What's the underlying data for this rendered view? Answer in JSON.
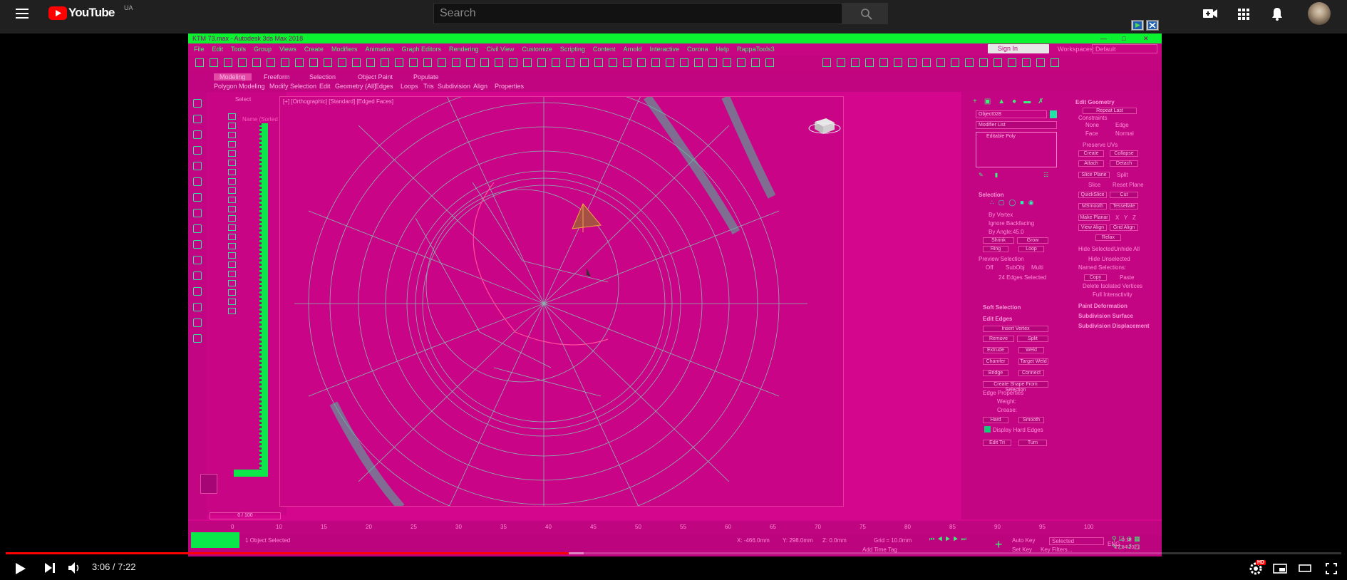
{
  "youtube": {
    "logo_text": "YouTube",
    "region": "UA",
    "search_placeholder": "Search",
    "icons": [
      "menu-icon",
      "youtube-logo-icon",
      "search-icon",
      "create-video-icon",
      "apps-icon",
      "notifications-icon",
      "avatar"
    ]
  },
  "max": {
    "window_title": "KTM 73.max - Autodesk 3ds Max 2018",
    "menu": [
      "File",
      "Edit",
      "Tools",
      "Group",
      "Views",
      "Create",
      "Modifiers",
      "Animation",
      "Graph Editors",
      "Rendering",
      "Civil View",
      "Customize",
      "Scripting",
      "Content",
      "Arnold",
      "Interactive",
      "Corona",
      "Help",
      "RappaTools3"
    ],
    "sign_in": "Sign In",
    "workspace_label": "Workspaces:",
    "workspace_value": "Default",
    "ribbon_tabs": [
      "Modeling",
      "Freeform",
      "Selection",
      "Object Paint",
      "Populate"
    ],
    "ribbon_subtabs": [
      "Polygon Modeling",
      "Modify Selection",
      "Edit",
      "Geometry (All)",
      "Edges",
      "Loops",
      "Tris",
      "Subdivision",
      "Align",
      "Properties"
    ],
    "viewport_label": "[+] [Orthographic] [Standard] [Edged Faces]",
    "scene_explorer_select": "Select",
    "scene_explorer_name": "Name (Sorted",
    "command_panel": {
      "object_name": "Object028",
      "modifier_list": "Modifier List",
      "stack_item": "Editable Poly",
      "selection_head": "Selection",
      "by_vertex": "By Vertex",
      "ignore_backfacing": "Ignore Backfacing",
      "by_angle": "By Angle:",
      "by_angle_value": "45.0",
      "shrink": "Shrink",
      "grow": "Grow",
      "ring": "Ring",
      "loop": "Loop",
      "preview_selection": "Preview Selection",
      "off": "Off",
      "subobj": "SubObj",
      "multi": "Multi",
      "edges_selected": "24 Edges Selected",
      "soft_selection": "Soft Selection",
      "edit_edges": "Edit Edges",
      "insert_vertex": "Insert Vertex",
      "remove": "Remove",
      "split": "Split",
      "extrude": "Extrude",
      "weld": "Weld",
      "chamfer": "Chamfer",
      "target_weld": "Target Weld",
      "bridge": "Bridge",
      "connect": "Connect",
      "create_shape": "Create Shape From Selection",
      "edge_properties": "Edge Properties",
      "weight": "Weight:",
      "crease": "Crease:",
      "hard": "Hard",
      "smooth": "Smooth",
      "display_hard_edges": "Display Hard Edges",
      "edit_tri": "Edit Tri",
      "turn": "Turn",
      "edit_geometry": "Edit Geometry",
      "repeat_last": "Repeat Last",
      "constraints": "Constraints",
      "none": "None",
      "edge": "Edge",
      "face": "Face",
      "normal": "Normal",
      "preserve_uvs": "Preserve UVs",
      "create": "Create",
      "collapse": "Collapse",
      "attach": "Attach",
      "detach": "Detach",
      "slice_plane": "Slice Plane",
      "split2": "Split",
      "slice": "Slice",
      "reset_plane": "Reset Plane",
      "quickslice": "QuickSlice",
      "cut": "Cut",
      "msmooth": "MSmooth",
      "tessellate": "Tessellate",
      "make_planar": "Make Planar",
      "x": "X",
      "y": "Y",
      "z": "Z",
      "view_align": "View Align",
      "grid_align": "Grid Align",
      "relax": "Relax",
      "hide_selected": "Hide Selected",
      "unhide_all": "Unhide All",
      "hide_unselected": "Hide Unselected",
      "named_selections": "Named Selections:",
      "copy": "Copy",
      "paste": "Paste",
      "delete_isolated": "Delete Isolated Vertices",
      "full_interactivity": "Full Interactivity",
      "paint_deformation": "Paint Deformation",
      "subdivision_surface": "Subdivision Surface",
      "subdivision_displacement": "Subdivision Displacement"
    },
    "timeline_frame": "0 / 100",
    "timeline_ticks": [
      "0",
      "10",
      "15",
      "20",
      "25",
      "30",
      "35",
      "40",
      "45",
      "50",
      "55",
      "60",
      "65",
      "70",
      "75",
      "80",
      "85",
      "90",
      "95",
      "100"
    ],
    "status_object": "1 Object Selected",
    "status_x": "X: -466.0mm",
    "status_y": "Y: 298.0mm",
    "status_z": "Z: 0.0mm",
    "status_grid": "Grid = 10.0mm",
    "auto_key": "Auto Key",
    "selected": "Selected",
    "set_key": "Set Key",
    "key_filters": "Key Filters...",
    "add_time_tag": "Add Time Tag",
    "taskbar_lang": "ENG",
    "taskbar_time": "0:18",
    "taskbar_date": "27.04.2021"
  },
  "player": {
    "time": "3:06 / 7:22",
    "played_fraction": 0.4217,
    "loaded_fraction": 0.433,
    "hd_badge": "HD",
    "icons": [
      "play-icon",
      "next-icon",
      "volume-icon",
      "settings-icon",
      "miniplayer-icon",
      "theater-icon",
      "fullscreen-icon"
    ]
  },
  "colors": {
    "yt_bar": "#202020",
    "video_bg": "#d4068e",
    "accent_green": "#0bf230",
    "progress_red": "#ff0000"
  }
}
